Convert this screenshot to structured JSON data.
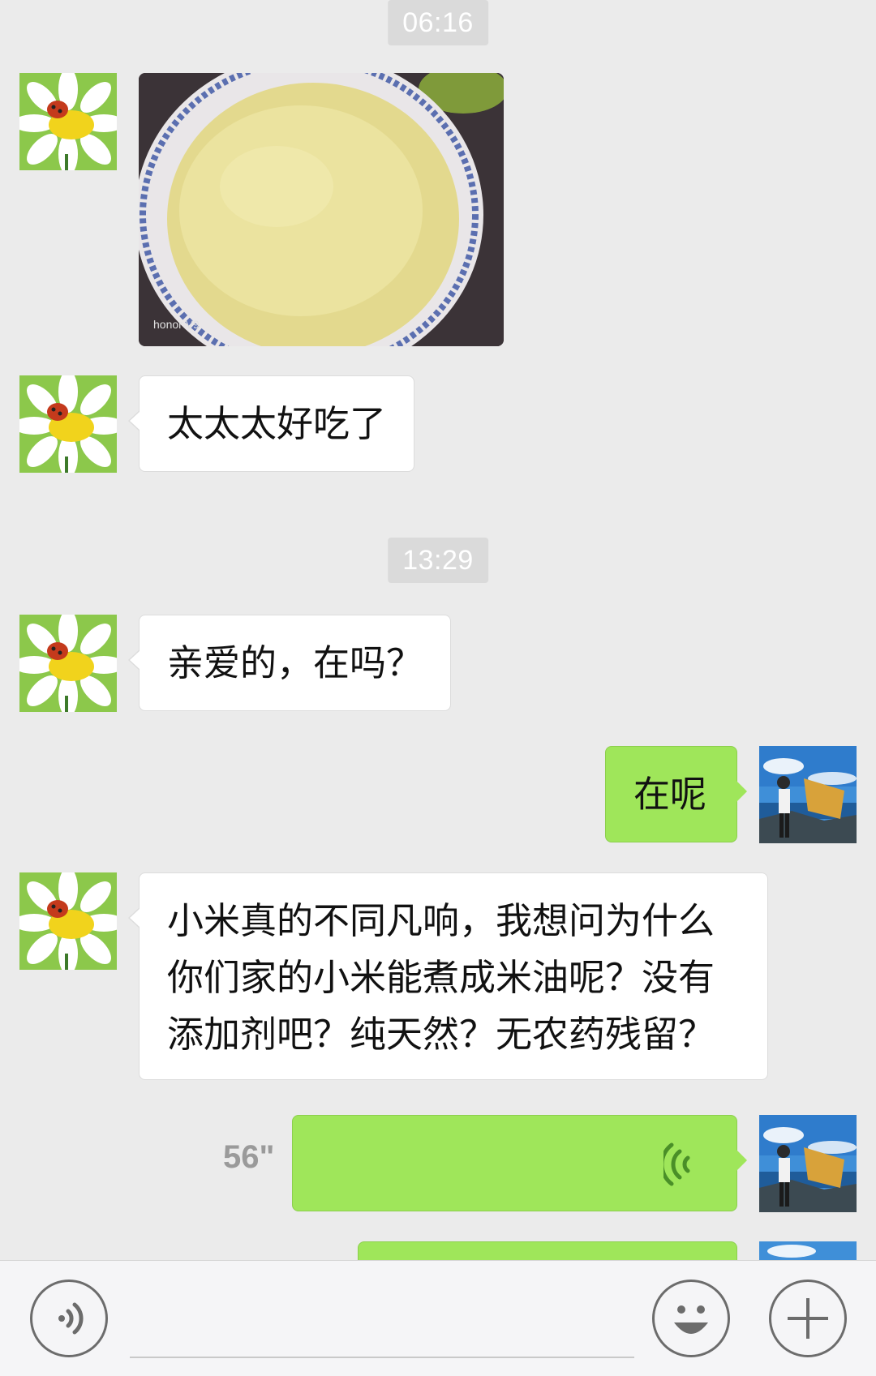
{
  "conversation": {
    "timestamps": [
      "06:16",
      "13:29"
    ],
    "messages": {
      "incoming_1": "太太太好吃了",
      "incoming_2": "亲爱的，在吗？",
      "outgoing_1": "在呢",
      "incoming_3": "小米真的不同凡响，我想问为什么你们家的小米能煮成米油呢？没有添加剂吧？纯天然？无农药残留？"
    },
    "voice_message": {
      "duration": "56\""
    },
    "photo_watermark": "honor V9"
  },
  "input_bar": {
    "placeholder": ""
  },
  "colors": {
    "background": "#ebebeb",
    "incoming_bubble": "#ffffff",
    "outgoing_bubble": "#9fe65a",
    "timestamp_bg": "#dadada"
  },
  "icons": {
    "voice_toggle": "voice-icon",
    "emoji": "emoji-icon",
    "more": "plus-icon",
    "voice_wave": "voice-wave-icon"
  }
}
